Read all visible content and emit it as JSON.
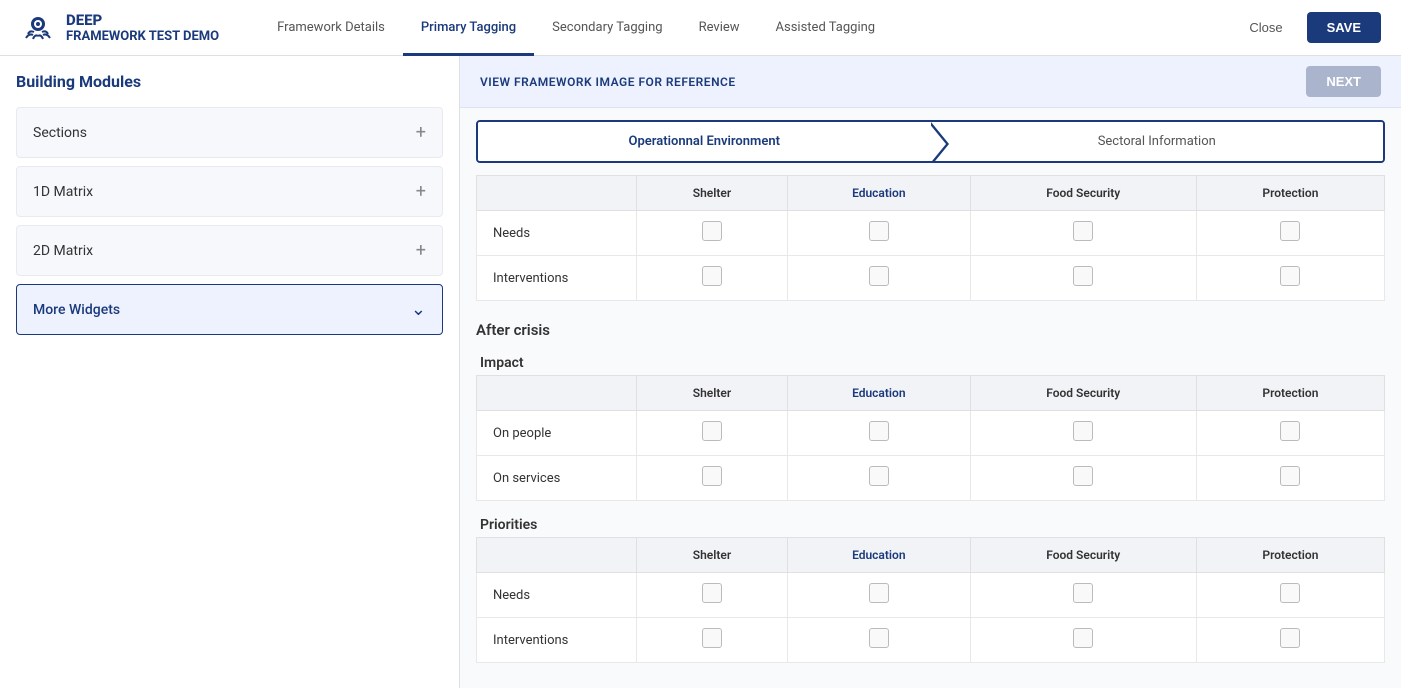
{
  "header": {
    "logo_name": "DEEP",
    "app_title": "FRAMEWORK TEST DEMO",
    "nav": [
      {
        "id": "framework-details",
        "label": "Framework Details",
        "active": false
      },
      {
        "id": "primary-tagging",
        "label": "Primary Tagging",
        "active": true
      },
      {
        "id": "secondary-tagging",
        "label": "Secondary Tagging",
        "active": false
      },
      {
        "id": "review",
        "label": "Review",
        "active": false
      },
      {
        "id": "assisted-tagging",
        "label": "Assisted Tagging",
        "active": false
      }
    ],
    "close_label": "Close",
    "save_label": "SAVE"
  },
  "sidebar": {
    "title": "Building Modules",
    "items": [
      {
        "id": "sections",
        "label": "Sections",
        "active": false,
        "icon": "+"
      },
      {
        "id": "1d-matrix",
        "label": "1D Matrix",
        "active": false,
        "icon": "+"
      },
      {
        "id": "2d-matrix",
        "label": "2D Matrix",
        "active": false,
        "icon": "+"
      },
      {
        "id": "more-widgets",
        "label": "More Widgets",
        "active": true,
        "icon": "v"
      }
    ]
  },
  "content": {
    "view_framework_label": "VIEW FRAMEWORK IMAGE FOR REFERENCE",
    "next_label": "NEXT",
    "tabs": [
      {
        "id": "operational",
        "label": "Operationnal Environment",
        "active": true
      },
      {
        "id": "sectoral",
        "label": "Sectoral Information",
        "active": false
      }
    ],
    "columns": [
      "Shelter",
      "Education",
      "Food Security",
      "Protection"
    ],
    "sections": [
      {
        "id": "after-crisis",
        "title": "After crisis",
        "subsections": [
          {
            "id": "impact",
            "title": "Impact",
            "rows": [
              {
                "id": "on-people",
                "label": "On people"
              },
              {
                "id": "on-services",
                "label": "On services"
              }
            ]
          },
          {
            "id": "priorities",
            "title": "Priorities",
            "rows": [
              {
                "id": "needs-p",
                "label": "Needs"
              },
              {
                "id": "interventions-p",
                "label": "Interventions"
              }
            ]
          }
        ]
      }
    ],
    "top_rows": [
      {
        "id": "needs-top",
        "label": "Needs"
      },
      {
        "id": "interventions-top",
        "label": "Interventions"
      }
    ]
  }
}
